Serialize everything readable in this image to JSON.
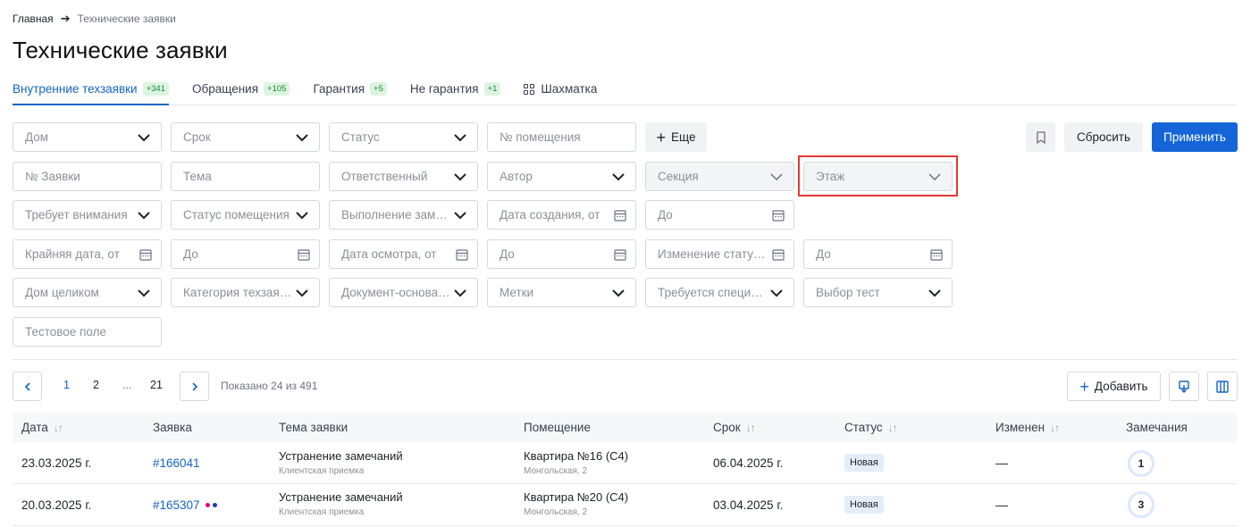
{
  "breadcrumb": {
    "home": "Главная",
    "current": "Технические заявки"
  },
  "page_title": "Технические заявки",
  "tabs": [
    {
      "label": "Внутренние техзаявки",
      "badge": "+341",
      "active": true
    },
    {
      "label": "Обращения",
      "badge": "+105"
    },
    {
      "label": "Гарантия",
      "badge": "+5"
    },
    {
      "label": "Не гарантия",
      "badge": "+1"
    },
    {
      "label": "Шахматка",
      "badge": ""
    }
  ],
  "filters": {
    "row1": [
      "Дом",
      "Срок",
      "Статус",
      "№ помещения"
    ],
    "more_label": "Еще",
    "row2": [
      "№ Заявки",
      "Тема",
      "Ответственный",
      "Автор",
      "Секция",
      "Этаж"
    ],
    "row3": [
      "Требует внимания",
      "Статус помещения",
      "Выполнение замечаний",
      "Дата создания, от",
      "До"
    ],
    "row4": [
      "Крайняя дата, от",
      "До",
      "Дата осмотра, от",
      "До",
      "Изменение статуса, от",
      "До"
    ],
    "row5": [
      "Дом целиком",
      "Категория техзаявки",
      "Документ-основание",
      "Метки",
      "Требуется специалист",
      "Выбор тест"
    ],
    "row6": [
      "Тестовое поле"
    ]
  },
  "actions": {
    "reset": "Сбросить",
    "apply": "Применить",
    "add": "Добавить"
  },
  "pagination": {
    "pages": [
      "1",
      "2",
      "...",
      "21"
    ],
    "current": "1",
    "shown": "Показано 24 из 491"
  },
  "table": {
    "headers": [
      "Дата",
      "Заявка",
      "Тема заявки",
      "Помещение",
      "Срок",
      "Статус",
      "Изменен",
      "Замечания"
    ],
    "rows": [
      {
        "date": "23.03.2025 г.",
        "id": "#166041",
        "topic": "Устранение замечаний",
        "topic_sub": "Клиентская приемка",
        "room": "Квартира №16 (С4)",
        "room_sub": "Монгольская, 2",
        "deadline": "06.04.2025 г.",
        "status": "Новая",
        "changed": "—",
        "remarks": "1"
      },
      {
        "date": "20.03.2025 г.",
        "id": "#165307",
        "topic": "Устранение замечаний",
        "topic_sub": "Клиентская приемка",
        "room": "Квартира №20 (С4)",
        "room_sub": "Монгольская, 2",
        "deadline": "03.04.2025 г.",
        "status": "Новая",
        "changed": "—",
        "remarks": "3"
      }
    ]
  },
  "colors": {
    "accent": "#1565d8",
    "highlight": "#e53935",
    "dot1": "#e6007e",
    "dot2": "#1e40af"
  }
}
